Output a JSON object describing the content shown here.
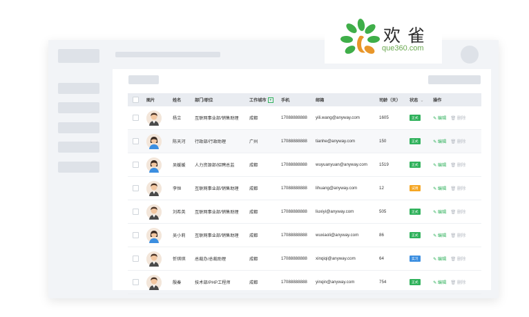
{
  "brand": {
    "cn_name": "欢雀",
    "url": "que360.com"
  },
  "table": {
    "headers": {
      "photo": "图片",
      "name": "姓名",
      "dept": "部门/职位",
      "city": "工作城市",
      "phone": "手机",
      "email": "邮箱",
      "days": "司龄（天）",
      "status": "状态",
      "ops": "操作"
    },
    "actions": {
      "edit": "编辑",
      "del": "删除"
    },
    "rows": [
      {
        "name": "杨立",
        "dept": "互联网事业部/销售助理",
        "city": "成都",
        "phone": "17088888888",
        "email": "yili.wang@anyway.com",
        "days": "1605",
        "status": "正式",
        "status_color": "#2fb15b",
        "gender": "male"
      },
      {
        "name": "陈天河",
        "dept": "行政部/行政助理",
        "city": "广州",
        "phone": "17088888888",
        "email": "tianhe@anyway.com",
        "days": "150",
        "status": "正式",
        "status_color": "#2fb15b",
        "gender": "female"
      },
      {
        "name": "吴媛媛",
        "dept": "人力资源部/招聘总监",
        "city": "成都",
        "phone": "17088888888",
        "email": "wuyuanyuan@anyway.com",
        "days": "1519",
        "status": "正式",
        "status_color": "#2fb15b",
        "gender": "female"
      },
      {
        "name": "李恒",
        "dept": "互联网事业部/销售助理",
        "city": "成都",
        "phone": "17088888888",
        "email": "lihuang@anyway.com",
        "days": "12",
        "status": "试用",
        "status_color": "#f5a623",
        "gender": "male"
      },
      {
        "name": "刘希英",
        "dept": "互联网事业部/销售助理",
        "city": "成都",
        "phone": "17088888888",
        "email": "liuxiyi@anyway.com",
        "days": "505",
        "status": "正式",
        "status_color": "#2fb15b",
        "gender": "male"
      },
      {
        "name": "吴小莉",
        "dept": "互联网事业部/销售助理",
        "city": "成都",
        "phone": "17088888888",
        "email": "wuxiaoli@anyway.com",
        "days": "86",
        "status": "正式",
        "status_color": "#2fb15b",
        "gender": "female"
      },
      {
        "name": "忻琪琪",
        "dept": "总裁办/总裁助理",
        "city": "成都",
        "phone": "17088888888",
        "email": "xinqiqi@anyway.com",
        "days": "64",
        "status": "实习",
        "status_color": "#3b8ee0",
        "gender": "male"
      },
      {
        "name": "殷秦",
        "dept": "技术部/PHP工程师",
        "city": "成都",
        "phone": "17088888888",
        "email": "yinqin@anyway.com",
        "days": "754",
        "status": "正式",
        "status_color": "#2fb15b",
        "gender": "male"
      }
    ]
  },
  "icons": {
    "edit": "edit-icon",
    "delete": "trash-icon",
    "filter": "filter-icon",
    "logo": "leaf-bird-logo-icon"
  }
}
